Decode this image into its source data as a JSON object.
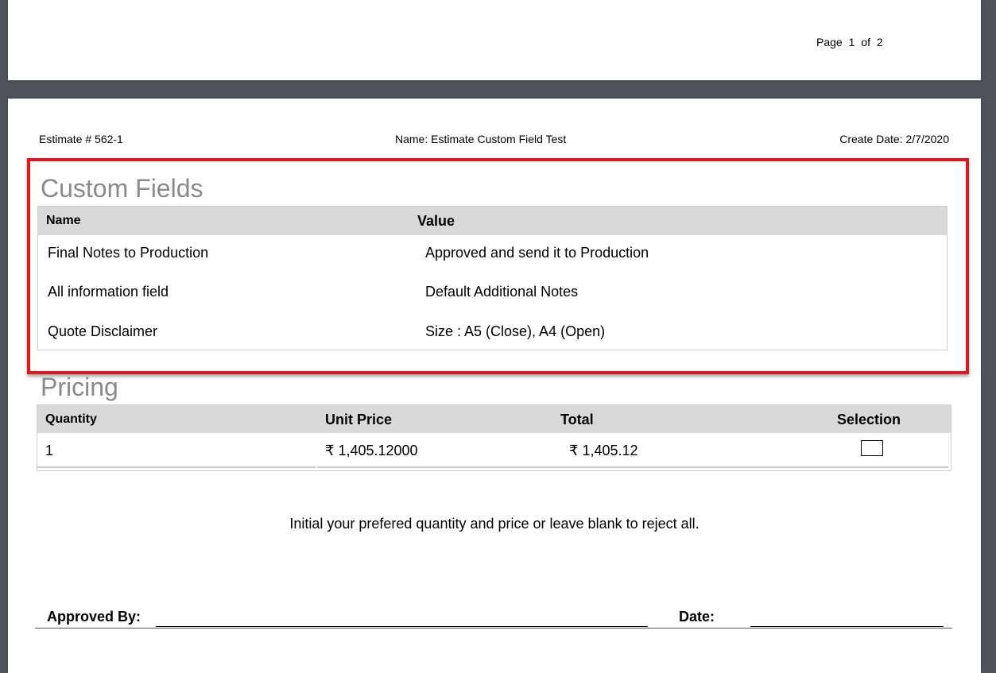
{
  "page_indicator": {
    "label": "Page",
    "current": "1",
    "of_label": "of",
    "total": "2"
  },
  "header": {
    "estimate": "Estimate # 562-1",
    "name": "Name: Estimate Custom Field Test",
    "create_date": "Create Date: 2/7/2020"
  },
  "custom_fields": {
    "title": "Custom Fields",
    "columns": [
      "Name",
      "Value"
    ],
    "rows": [
      {
        "name": "Final Notes to Production",
        "value": "Approved and send it to Production"
      },
      {
        "name": "All information field",
        "value": "Default Additional Notes"
      },
      {
        "name": "Quote Disclaimer",
        "value": "Size : A5 (Close), A4 (Open)"
      }
    ]
  },
  "pricing": {
    "title": "Pricing",
    "columns": [
      "Quantity",
      "Unit Price",
      "Total",
      "Selection"
    ],
    "rows": [
      {
        "quantity": "1",
        "unit_price": "₹ 1,405.12000",
        "total": "₹ 1,405.12",
        "selected": false
      }
    ]
  },
  "note": "Initial your prefered quantity and price or leave blank to reject all.",
  "signature": {
    "approved_by_label": "Approved By:",
    "date_label": "Date:"
  },
  "colors": {
    "highlight": "#e0181b",
    "header_bg": "#d9d9d9",
    "section_title": "#8a8a8a",
    "viewer_bg": "#50545a"
  }
}
